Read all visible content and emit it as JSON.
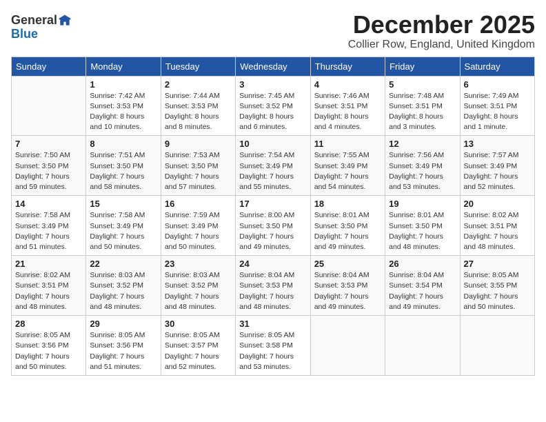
{
  "header": {
    "logo_general": "General",
    "logo_blue": "Blue",
    "month_title": "December 2025",
    "location": "Collier Row, England, United Kingdom"
  },
  "days_of_week": [
    "Sunday",
    "Monday",
    "Tuesday",
    "Wednesday",
    "Thursday",
    "Friday",
    "Saturday"
  ],
  "weeks": [
    [
      {
        "day": "",
        "content": ""
      },
      {
        "day": "1",
        "content": "Sunrise: 7:42 AM\nSunset: 3:53 PM\nDaylight: 8 hours\nand 10 minutes."
      },
      {
        "day": "2",
        "content": "Sunrise: 7:44 AM\nSunset: 3:53 PM\nDaylight: 8 hours\nand 8 minutes."
      },
      {
        "day": "3",
        "content": "Sunrise: 7:45 AM\nSunset: 3:52 PM\nDaylight: 8 hours\nand 6 minutes."
      },
      {
        "day": "4",
        "content": "Sunrise: 7:46 AM\nSunset: 3:51 PM\nDaylight: 8 hours\nand 4 minutes."
      },
      {
        "day": "5",
        "content": "Sunrise: 7:48 AM\nSunset: 3:51 PM\nDaylight: 8 hours\nand 3 minutes."
      },
      {
        "day": "6",
        "content": "Sunrise: 7:49 AM\nSunset: 3:51 PM\nDaylight: 8 hours\nand 1 minute."
      }
    ],
    [
      {
        "day": "7",
        "content": "Sunrise: 7:50 AM\nSunset: 3:50 PM\nDaylight: 7 hours\nand 59 minutes."
      },
      {
        "day": "8",
        "content": "Sunrise: 7:51 AM\nSunset: 3:50 PM\nDaylight: 7 hours\nand 58 minutes."
      },
      {
        "day": "9",
        "content": "Sunrise: 7:53 AM\nSunset: 3:50 PM\nDaylight: 7 hours\nand 57 minutes."
      },
      {
        "day": "10",
        "content": "Sunrise: 7:54 AM\nSunset: 3:49 PM\nDaylight: 7 hours\nand 55 minutes."
      },
      {
        "day": "11",
        "content": "Sunrise: 7:55 AM\nSunset: 3:49 PM\nDaylight: 7 hours\nand 54 minutes."
      },
      {
        "day": "12",
        "content": "Sunrise: 7:56 AM\nSunset: 3:49 PM\nDaylight: 7 hours\nand 53 minutes."
      },
      {
        "day": "13",
        "content": "Sunrise: 7:57 AM\nSunset: 3:49 PM\nDaylight: 7 hours\nand 52 minutes."
      }
    ],
    [
      {
        "day": "14",
        "content": "Sunrise: 7:58 AM\nSunset: 3:49 PM\nDaylight: 7 hours\nand 51 minutes."
      },
      {
        "day": "15",
        "content": "Sunrise: 7:58 AM\nSunset: 3:49 PM\nDaylight: 7 hours\nand 50 minutes."
      },
      {
        "day": "16",
        "content": "Sunrise: 7:59 AM\nSunset: 3:49 PM\nDaylight: 7 hours\nand 50 minutes."
      },
      {
        "day": "17",
        "content": "Sunrise: 8:00 AM\nSunset: 3:50 PM\nDaylight: 7 hours\nand 49 minutes."
      },
      {
        "day": "18",
        "content": "Sunrise: 8:01 AM\nSunset: 3:50 PM\nDaylight: 7 hours\nand 49 minutes."
      },
      {
        "day": "19",
        "content": "Sunrise: 8:01 AM\nSunset: 3:50 PM\nDaylight: 7 hours\nand 48 minutes."
      },
      {
        "day": "20",
        "content": "Sunrise: 8:02 AM\nSunset: 3:51 PM\nDaylight: 7 hours\nand 48 minutes."
      }
    ],
    [
      {
        "day": "21",
        "content": "Sunrise: 8:02 AM\nSunset: 3:51 PM\nDaylight: 7 hours\nand 48 minutes."
      },
      {
        "day": "22",
        "content": "Sunrise: 8:03 AM\nSunset: 3:52 PM\nDaylight: 7 hours\nand 48 minutes."
      },
      {
        "day": "23",
        "content": "Sunrise: 8:03 AM\nSunset: 3:52 PM\nDaylight: 7 hours\nand 48 minutes."
      },
      {
        "day": "24",
        "content": "Sunrise: 8:04 AM\nSunset: 3:53 PM\nDaylight: 7 hours\nand 48 minutes."
      },
      {
        "day": "25",
        "content": "Sunrise: 8:04 AM\nSunset: 3:53 PM\nDaylight: 7 hours\nand 49 minutes."
      },
      {
        "day": "26",
        "content": "Sunrise: 8:04 AM\nSunset: 3:54 PM\nDaylight: 7 hours\nand 49 minutes."
      },
      {
        "day": "27",
        "content": "Sunrise: 8:05 AM\nSunset: 3:55 PM\nDaylight: 7 hours\nand 50 minutes."
      }
    ],
    [
      {
        "day": "28",
        "content": "Sunrise: 8:05 AM\nSunset: 3:56 PM\nDaylight: 7 hours\nand 50 minutes."
      },
      {
        "day": "29",
        "content": "Sunrise: 8:05 AM\nSunset: 3:56 PM\nDaylight: 7 hours\nand 51 minutes."
      },
      {
        "day": "30",
        "content": "Sunrise: 8:05 AM\nSunset: 3:57 PM\nDaylight: 7 hours\nand 52 minutes."
      },
      {
        "day": "31",
        "content": "Sunrise: 8:05 AM\nSunset: 3:58 PM\nDaylight: 7 hours\nand 53 minutes."
      },
      {
        "day": "",
        "content": ""
      },
      {
        "day": "",
        "content": ""
      },
      {
        "day": "",
        "content": ""
      }
    ]
  ]
}
